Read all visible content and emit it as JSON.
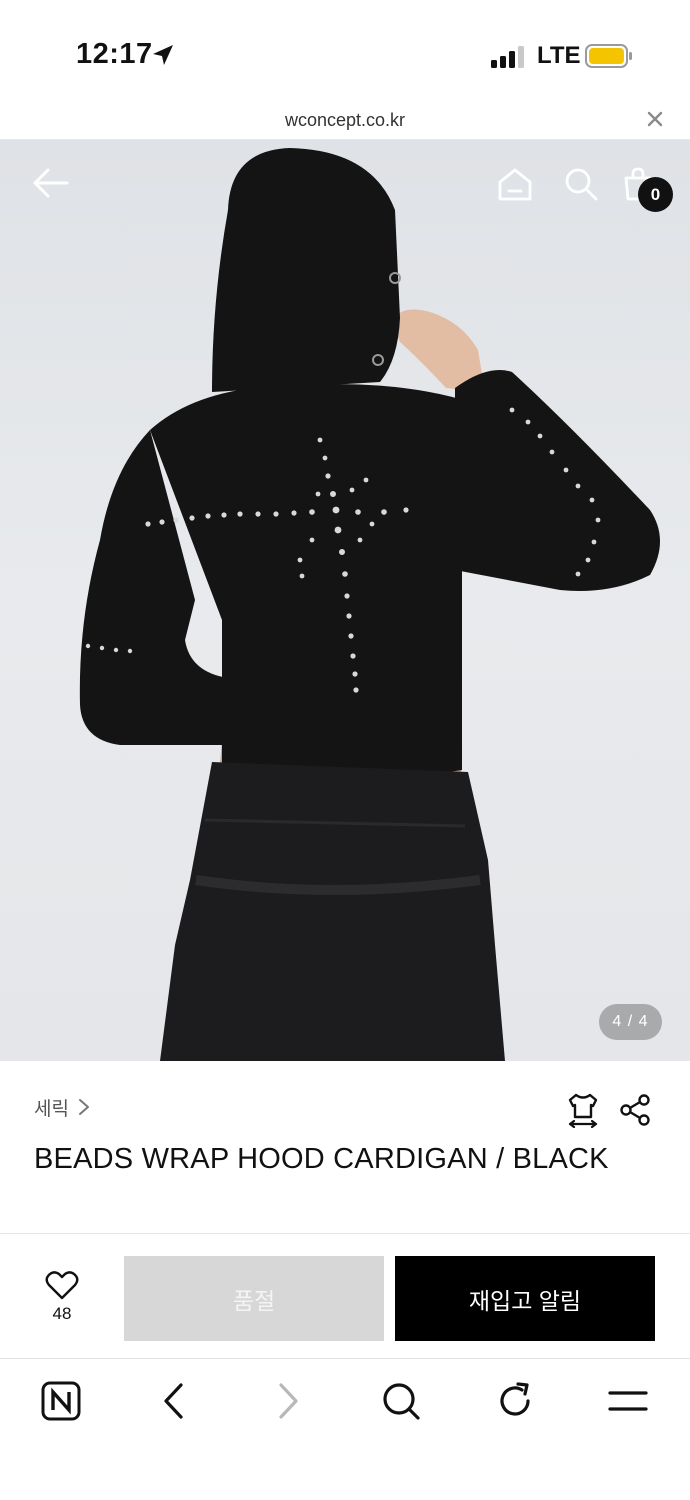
{
  "status_bar": {
    "time": "12:17",
    "network": "LTE",
    "icons": [
      "location-arrow-icon",
      "cellular-signal-icon",
      "battery-icon"
    ]
  },
  "url_bar": {
    "url": "wconcept.co.kr"
  },
  "product_image": {
    "page_indicator": "4 / 4",
    "cart_count": "0",
    "icons": [
      "back-arrow-icon",
      "home-icon",
      "search-icon",
      "shopping-bag-icon"
    ]
  },
  "product": {
    "brand": "세릭",
    "title": "BEADS WRAP HOOD CARDIGAN / BLACK",
    "icons": [
      "size-guide-icon",
      "share-icon"
    ]
  },
  "purchase_bar": {
    "like_count": "48",
    "soldout_label": "품절",
    "restock_label": "재입고 알림"
  },
  "browser_toolbar": {
    "icons": [
      "naver-home-icon",
      "back-icon",
      "forward-icon",
      "search-icon",
      "refresh-icon",
      "menu-icon"
    ]
  },
  "colors": {
    "primary_button": "#000000",
    "disabled_button": "#d7d7d7",
    "battery": "#f5c400"
  }
}
